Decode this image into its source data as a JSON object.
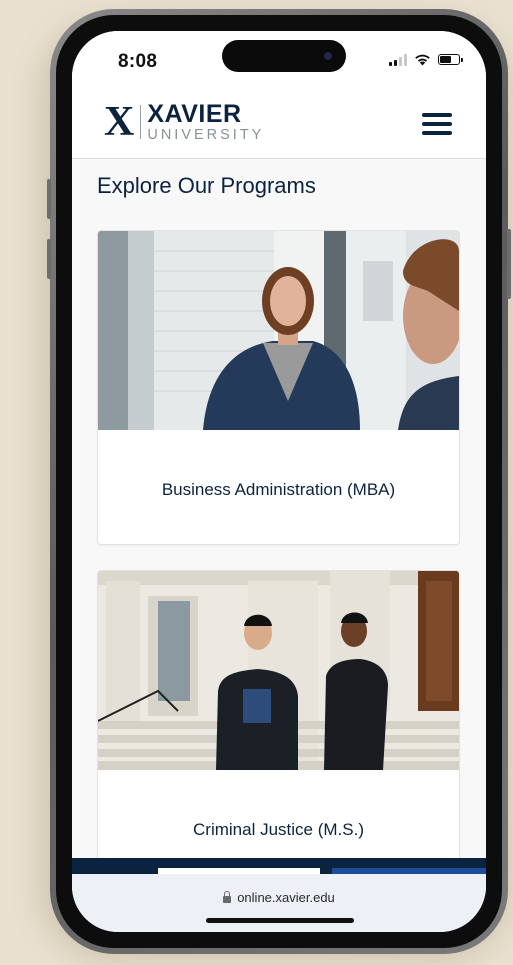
{
  "status_bar": {
    "time": "8:08",
    "signal_icon": "cellular-signal-icon",
    "wifi_icon": "wifi-icon",
    "battery_icon": "battery-icon"
  },
  "header": {
    "logo_mark": "X",
    "logo_name": "XAVIER",
    "logo_sub": "UNIVERSITY",
    "menu_icon": "hamburger-menu-icon"
  },
  "main": {
    "title": "Explore Our Programs",
    "programs": [
      {
        "title": "Business Administration (MBA)",
        "image": "photo-businesswoman-office"
      },
      {
        "title": "Criminal Justice (M.S.)",
        "image": "photo-professionals-courthouse-steps"
      }
    ]
  },
  "browser": {
    "url": "online.xavier.edu",
    "lock_icon": "lock-icon"
  },
  "colors": {
    "brand_navy": "#0c2340",
    "accent_blue": "#1d4c9b",
    "page_bg": "#f8f8f8",
    "backdrop": "#e9e0cf"
  }
}
